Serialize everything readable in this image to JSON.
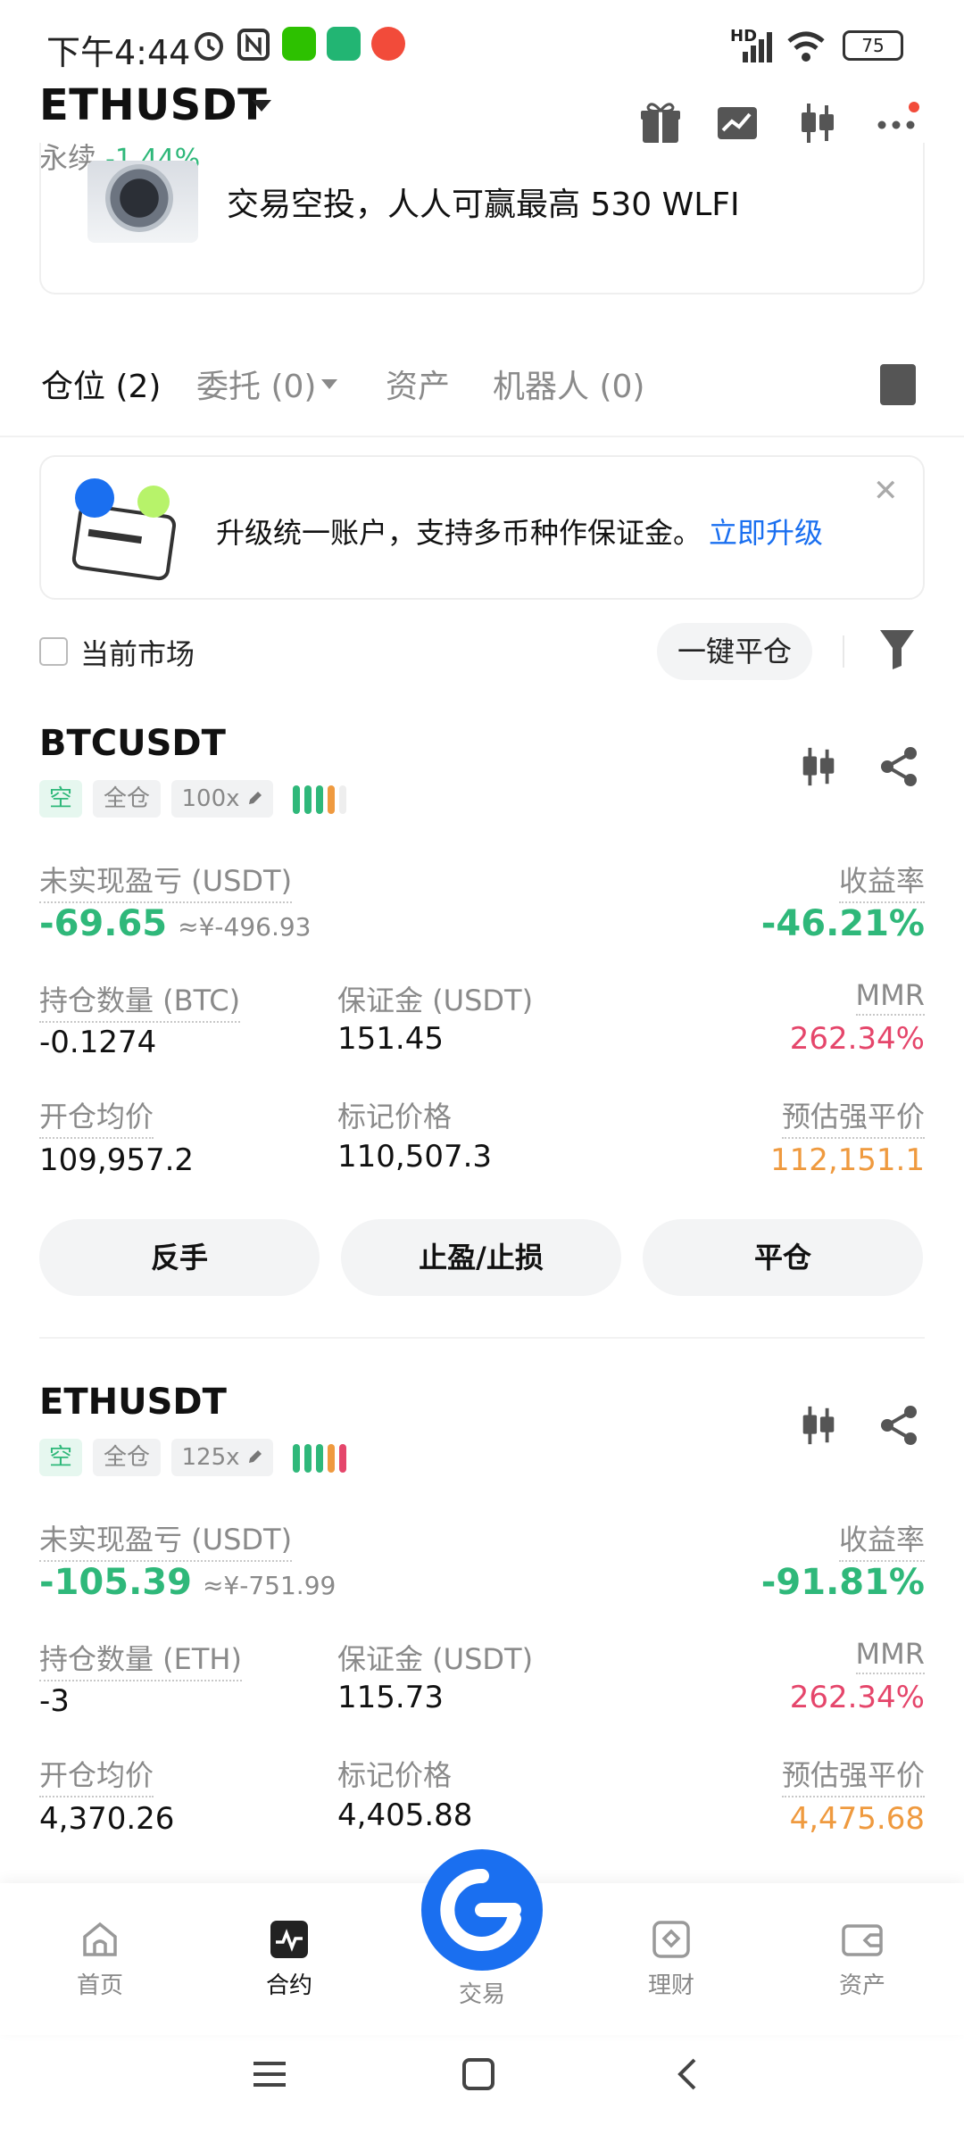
{
  "status_bar": {
    "time": "下午4:44",
    "battery": "75",
    "network": "HD"
  },
  "header": {
    "symbol": "ETHUSDT",
    "subtitle": "永续",
    "change": "-1.44%"
  },
  "banner": {
    "text": "交易空投，人人可赢最高 530 WLFI"
  },
  "tabs": [
    {
      "label": "仓位 (2)"
    },
    {
      "label": "委托 (0)"
    },
    {
      "label": "资产"
    },
    {
      "label": "机器人 (0)"
    }
  ],
  "upgrade": {
    "text": "升级统一账户，支持多币种作保证金。",
    "link": "立即升级"
  },
  "filter": {
    "current_market": "当前市场",
    "close_all": "一键平仓"
  },
  "positions": [
    {
      "symbol": "BTCUSDT",
      "side": "空",
      "mode": "全仓",
      "leverage": "100x",
      "pnl_label": "未实现盈亏 (USDT)",
      "pnl": "-69.65",
      "pnl_cny": "≈¥-496.93",
      "roe_label": "收益率",
      "roe": "-46.21%",
      "qty_label": "持仓数量 (BTC)",
      "qty": "-0.1274",
      "margin_label": "保证金 (USDT)",
      "margin": "151.45",
      "mmr_label": "MMR",
      "mmr": "262.34%",
      "entry_label": "开仓均价",
      "entry": "109,957.2",
      "mark_label": "标记价格",
      "mark": "110,507.3",
      "liq_label": "预估强平价",
      "liq": "112,151.1",
      "btn_reverse": "反手",
      "btn_tpsl": "止盈/止损",
      "btn_close": "平仓"
    },
    {
      "symbol": "ETHUSDT",
      "side": "空",
      "mode": "全仓",
      "leverage": "125x",
      "pnl_label": "未实现盈亏 (USDT)",
      "pnl": "-105.39",
      "pnl_cny": "≈¥-751.99",
      "roe_label": "收益率",
      "roe": "-91.81%",
      "qty_label": "持仓数量 (ETH)",
      "qty": "-3",
      "margin_label": "保证金 (USDT)",
      "margin": "115.73",
      "mmr_label": "MMR",
      "mmr": "262.34%",
      "entry_label": "开仓均价",
      "entry": "4,370.26",
      "mark_label": "标记价格",
      "mark": "4,405.88",
      "liq_label": "预估强平价",
      "liq": "4,475.68"
    }
  ],
  "bottom_nav": [
    {
      "label": "首页",
      "icon": "home-icon"
    },
    {
      "label": "合约",
      "icon": "futures-icon"
    },
    {
      "label": "交易",
      "icon": "trade-icon"
    },
    {
      "label": "理财",
      "icon": "earn-icon"
    },
    {
      "label": "资产",
      "icon": "wallet-icon"
    }
  ],
  "colors": {
    "green": "#2fb87a",
    "red": "#e5466b",
    "orange": "#ef9a3f",
    "brand": "#1a6ff0"
  }
}
